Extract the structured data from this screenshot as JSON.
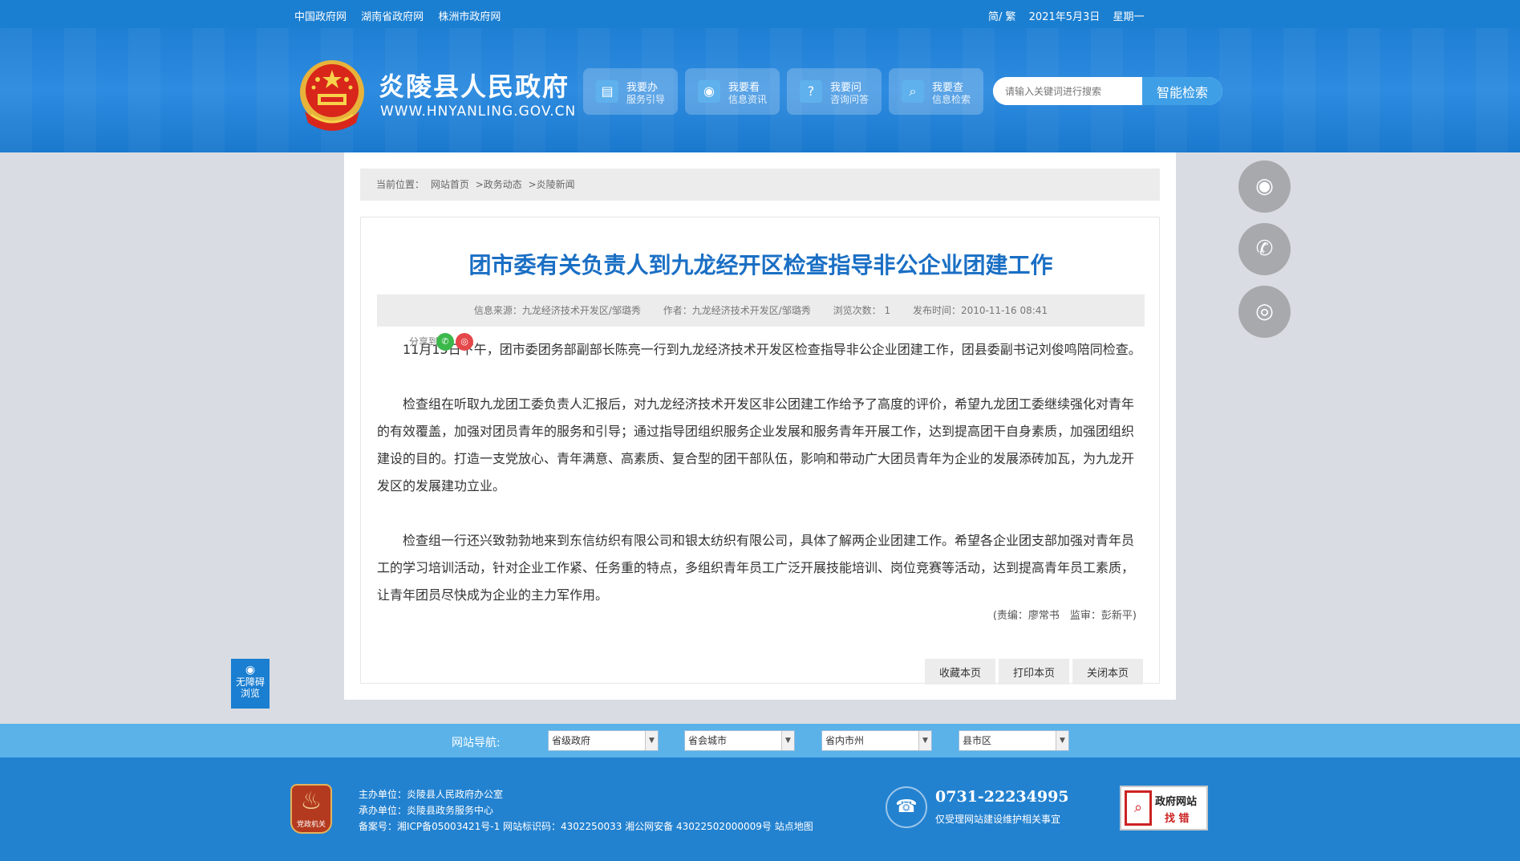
{
  "topbar": {
    "links": [
      "中国政府网",
      "湖南省政府网",
      "株洲市政府网"
    ],
    "lang": "简/ 繁",
    "date": "2021年5月3日",
    "weekday": "星期一"
  },
  "header": {
    "title": "炎陵县人民政府",
    "url": "WWW.HNYANLING.GOV.CN",
    "nav": [
      {
        "t1": "我要办",
        "t2": "服务引导",
        "icon": "document-icon"
      },
      {
        "t1": "我要看",
        "t2": "信息资讯",
        "icon": "eye-icon"
      },
      {
        "t1": "我要问",
        "t2": "咨询问答",
        "icon": "question-icon"
      },
      {
        "t1": "我要查",
        "t2": "信息检索",
        "icon": "search-icon"
      }
    ],
    "search_placeholder": "请输入关键词进行搜索",
    "search_button": "智能检索"
  },
  "breadcrumb": {
    "prefix": "当前位置：",
    "items": [
      "网站首页",
      ">政务动态",
      ">炎陵新闻"
    ]
  },
  "article": {
    "title": "团市委有关负责人到九龙经开区检查指导非公企业团建工作",
    "meta": {
      "source": "信息来源：九龙经济技术开发区/邹璐秀",
      "author": "作者：九龙经济技术开发区/邹璐秀",
      "views": "浏览次数： 1",
      "time": "发布时间：2010-11-16 08:41"
    },
    "share_label": "分享到",
    "paragraphs": [
      "11月15日下午，团市委团务部副部长陈亮一行到九龙经济技术开发区检查指导非公企业团建工作，团县委副书记刘俊鸣陪同检查。",
      "检查组在听取九龙团工委负责人汇报后，对九龙经济技术开发区非公团建工作给予了高度的评价，希望九龙团工委继续强化对青年的有效覆盖，加强对团员青年的服务和引导；通过指导团组织服务企业发展和服务青年开展工作，达到提高团干自身素质，加强团组织建设的目的。打造一支党放心、青年满意、高素质、复合型的团干部队伍，影响和带动广大团员青年为企业的发展添砖加瓦，为九龙开发区的发展建功立业。",
      "检查组一行还兴致勃勃地来到东信纺织有限公司和银太纺织有限公司，具体了解两企业团建工作。希望各企业团支部加强对青年员工的学习培训活动，针对企业工作紧、任务重的特点，多组织青年员工广泛开展技能培训、岗位竞赛等活动，达到提高青年员工素质，让青年团员尽快成为企业的主力军作用。"
    ],
    "signature": "(责编：廖常书　监审：彭新平)",
    "actions": [
      "收藏本页",
      "打印本页",
      "关闭本页"
    ]
  },
  "side": {
    "access_label1": "无障碍",
    "access_label2": "浏览"
  },
  "site_nav": {
    "label": "网站导航:",
    "selects": [
      "省级政府",
      "省会城市",
      "省内市州",
      "县市区"
    ]
  },
  "footer": {
    "badge_text": "党政机关",
    "host": "主办单位：炎陵县人民政府办公室",
    "organizer": "承办单位：炎陵县政务服务中心",
    "record": "备案号：湘ICP备05003421号-1 网站标识码：4302250033 湘公网安备 43022502000009号 站点地图",
    "phone": "0731-22234995",
    "phone_note": "仅受理网站建设维护相关事宜",
    "find_error_l1": "政府网站",
    "find_error_l2": "找 错"
  },
  "colors": {
    "brand_blue": "#1b7fd1",
    "title_blue": "#1a6fc4",
    "nav_strip": "#5ab2e9",
    "footer_blue": "#2382d0"
  }
}
